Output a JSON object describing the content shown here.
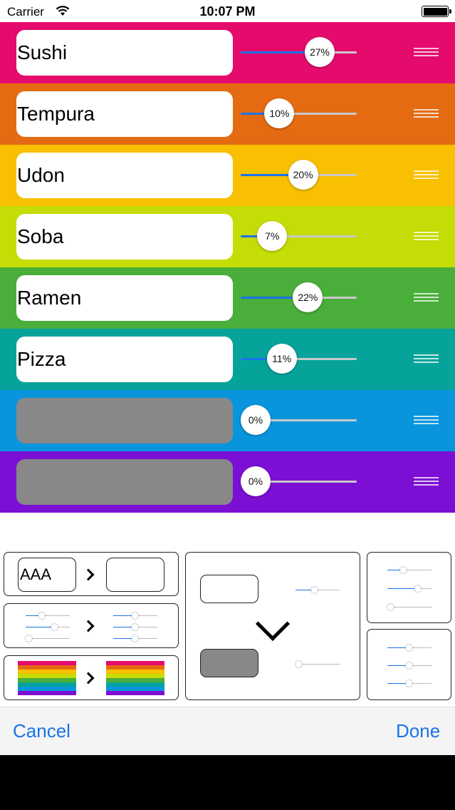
{
  "status_bar": {
    "carrier": "Carrier",
    "time": "10:07 PM"
  },
  "rows": [
    {
      "name": "Sushi",
      "percent": "27%",
      "value": 0.27,
      "color": "#e40b6d"
    },
    {
      "name": "Tempura",
      "percent": "10%",
      "value": 0.1,
      "color": "#e46b12"
    },
    {
      "name": "Udon",
      "percent": "20%",
      "value": 0.2,
      "color": "#f8c000"
    },
    {
      "name": "Soba",
      "percent": "7%",
      "value": 0.07,
      "color": "#c6dc06"
    },
    {
      "name": "Ramen",
      "percent": "22%",
      "value": 0.22,
      "color": "#4aae3a"
    },
    {
      "name": "Pizza",
      "percent": "11%",
      "value": 0.11,
      "color": "#06a39a"
    },
    {
      "name": "",
      "percent": "0%",
      "value": 0.0,
      "color": "#0995dc"
    },
    {
      "name": "",
      "percent": "0%",
      "value": 0.0,
      "color": "#7c0fd4"
    }
  ],
  "options": {
    "rename_example": "AAA",
    "flag_colors": [
      "#e40b6d",
      "#e46b12",
      "#f8c000",
      "#c6dc06",
      "#4aae3a",
      "#06a39a",
      "#0995dc",
      "#7c0fd4"
    ]
  },
  "toolbar": {
    "cancel_label": "Cancel",
    "done_label": "Done"
  }
}
